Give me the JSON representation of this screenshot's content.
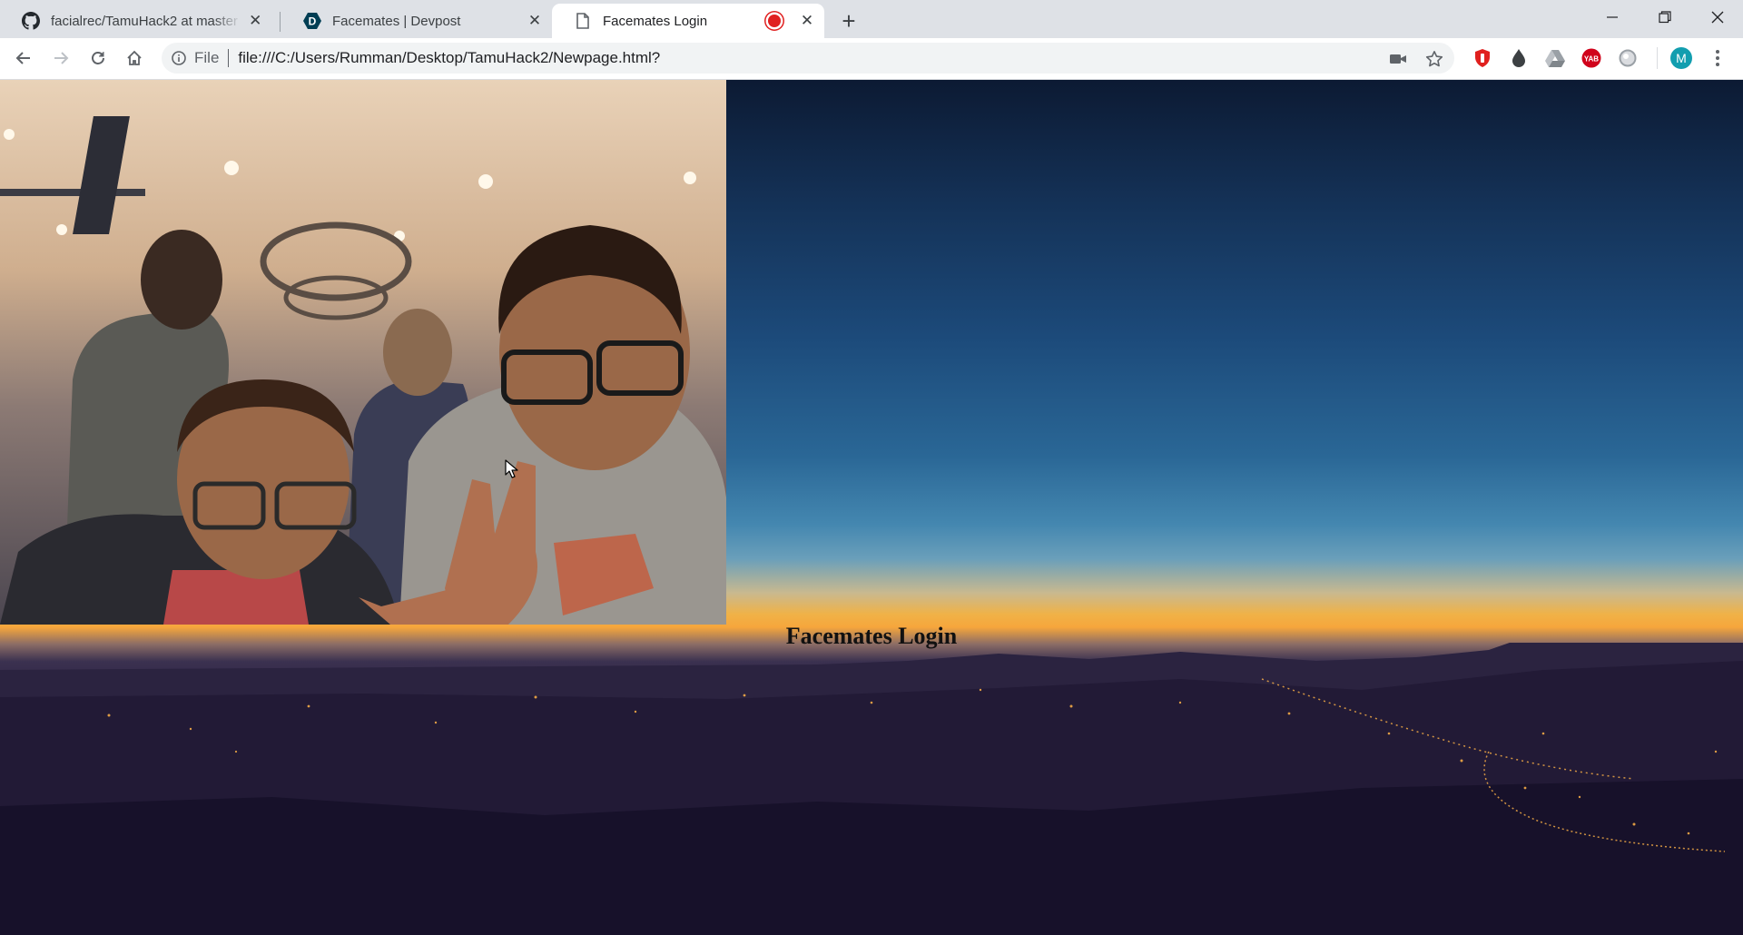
{
  "browser": {
    "tabs": [
      {
        "title": "facialrec/TamuHack2 at master · ",
        "favicon": "github-icon",
        "active": false
      },
      {
        "title": "Facemates | Devpost",
        "favicon": "devpost-icon",
        "active": false
      },
      {
        "title": "Facemates Login",
        "favicon": "page-icon",
        "active": true,
        "recording": true
      }
    ],
    "new_tab_icon": "plus-icon",
    "window_controls": [
      "minimize-icon",
      "maximize-icon",
      "close-icon"
    ]
  },
  "toolbar": {
    "buttons": [
      "back-icon",
      "forward-icon",
      "reload-icon",
      "home-icon"
    ],
    "scheme_label": "File",
    "url": "file:///C:/Users/Rumman/Desktop/TamuHack2/Newpage.html?",
    "omnibox_icons": [
      "camera-icon",
      "star-icon"
    ],
    "extensions": [
      "shield-extension-icon",
      "drop-extension-icon",
      "drive-extension-icon",
      "yab-extension-icon",
      "circle-extension-icon"
    ],
    "yab_badge": "YAB",
    "avatar_letter": "M",
    "accent": "#129eaf"
  },
  "page": {
    "heading": "Facemates Login",
    "webcam": "webcam-video-feed",
    "background": "night-city-sunset-landscape"
  }
}
